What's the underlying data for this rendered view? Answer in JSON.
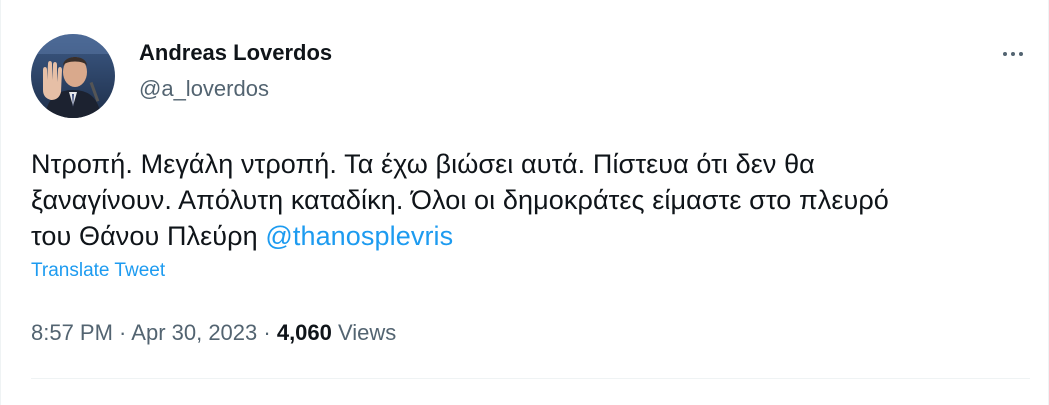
{
  "author": {
    "name": "Andreas Loverdos",
    "handle": "@a_loverdos"
  },
  "tweet": {
    "text_line1": "Ντροπή. Μεγάλη ντροπή. Τα έχω βιώσει αυτά. Πίστευα ότι δεν θα",
    "text_line2": "ξαναγίνουν. Απόλυτη καταδίκη. Όλοι οι δημοκράτες είμαστε στο πλευρό",
    "text_line3": "του Θάνου Πλεύρη ",
    "mention": "@thanosplevris",
    "translate_label": "Translate Tweet"
  },
  "meta": {
    "time": "8:57 PM",
    "sep1": " · ",
    "date": "Apr 30, 2023",
    "sep2": " · ",
    "views_count": "4,060",
    "views_label": " Views"
  },
  "colors": {
    "link": "#1d9bf0",
    "secondary": "#536471",
    "primary": "#0f1419"
  },
  "icons": {
    "more": "more-horizontal-icon"
  }
}
